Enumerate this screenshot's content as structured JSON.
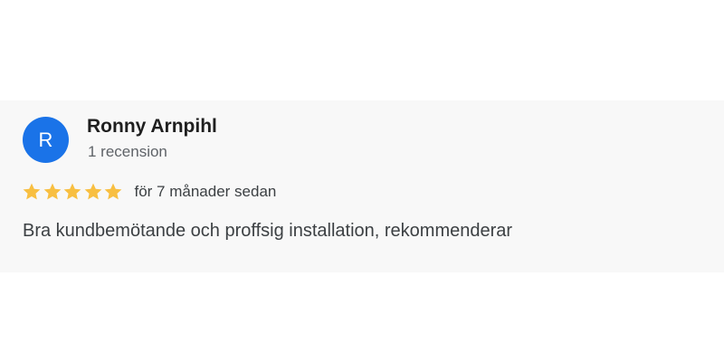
{
  "review": {
    "avatar_letter": "R",
    "reviewer_name": "Ronny Arnpihl",
    "review_count": "1 recension",
    "rating": 5,
    "rating_max": 5,
    "star_icon": "star-icon",
    "time_ago": "för 7 månader sedan",
    "text": "Bra kundbemötande och proffsig installation, rekommenderar"
  },
  "colors": {
    "avatar_bg": "#1a73e8",
    "star": "#f8bf41",
    "card_bg": "#f8f8f8"
  }
}
